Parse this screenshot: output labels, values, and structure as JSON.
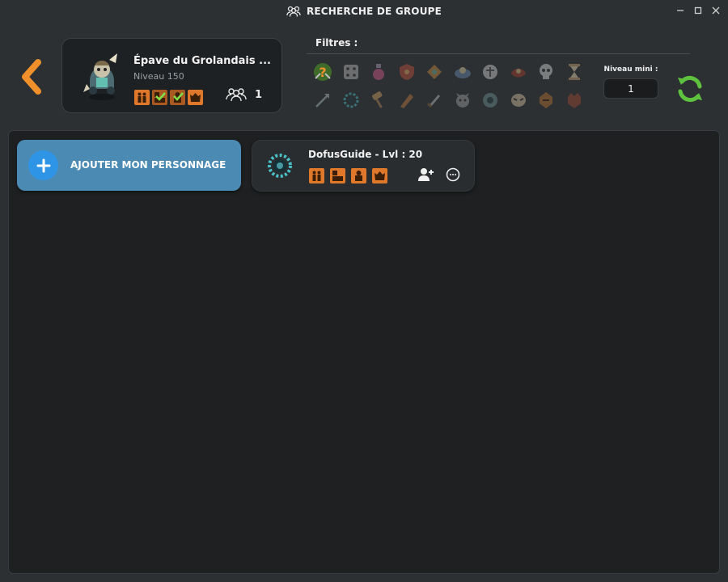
{
  "window": {
    "title": "RECHERCHE DE GROUPE",
    "icon": "group-icon",
    "controls": [
      "minimize-icon",
      "maximize-icon",
      "close-icon"
    ]
  },
  "dungeon": {
    "name": "Épave du Grolandais  ...",
    "level": "Niveau 150",
    "badges": [
      {
        "icon": "group-icon",
        "done": false
      },
      {
        "icon": "map-icon",
        "done": true
      },
      {
        "icon": "monster-icon",
        "done": true
      },
      {
        "icon": "boss-icon",
        "done": false
      }
    ],
    "party_count": "1"
  },
  "filters": {
    "label": "Filtres :",
    "min_level_label": "Niveau mini :",
    "min_level_value": "1",
    "icons": [
      "random-class-icon",
      "ecaflip-dice-icon",
      "eniripsa-potion-icon",
      "iop-shield-icon",
      "cra-emblem-icon",
      "sadida-icon",
      "osamodas-icon",
      "sram-icon",
      "skull-icon",
      "xelor-hourglass-icon",
      "arrow-icon",
      "eliotrope-portal-icon",
      "hammer-icon",
      "pandawa-icon",
      "sword-icon",
      "sacrier-icon",
      "foggernaut-icon",
      "masqueraider-icon",
      "rogue-icon",
      "ouginak-icon"
    ],
    "active_index": 0
  },
  "add_character": {
    "label": "AJOUTER MON PERSONNAGE"
  },
  "player": {
    "name": "DofusGuide - Lvl : 20",
    "badges": [
      "group-icon",
      "map-icon",
      "monster-icon",
      "boss-icon"
    ],
    "actions": [
      "add-friend-icon",
      "chat-icon"
    ]
  },
  "colors": {
    "accent_orange": "#f0902a",
    "add_button": "#4b8ab2",
    "plus_circle": "#2e95e6",
    "refresh_green": "#5fc23f"
  }
}
